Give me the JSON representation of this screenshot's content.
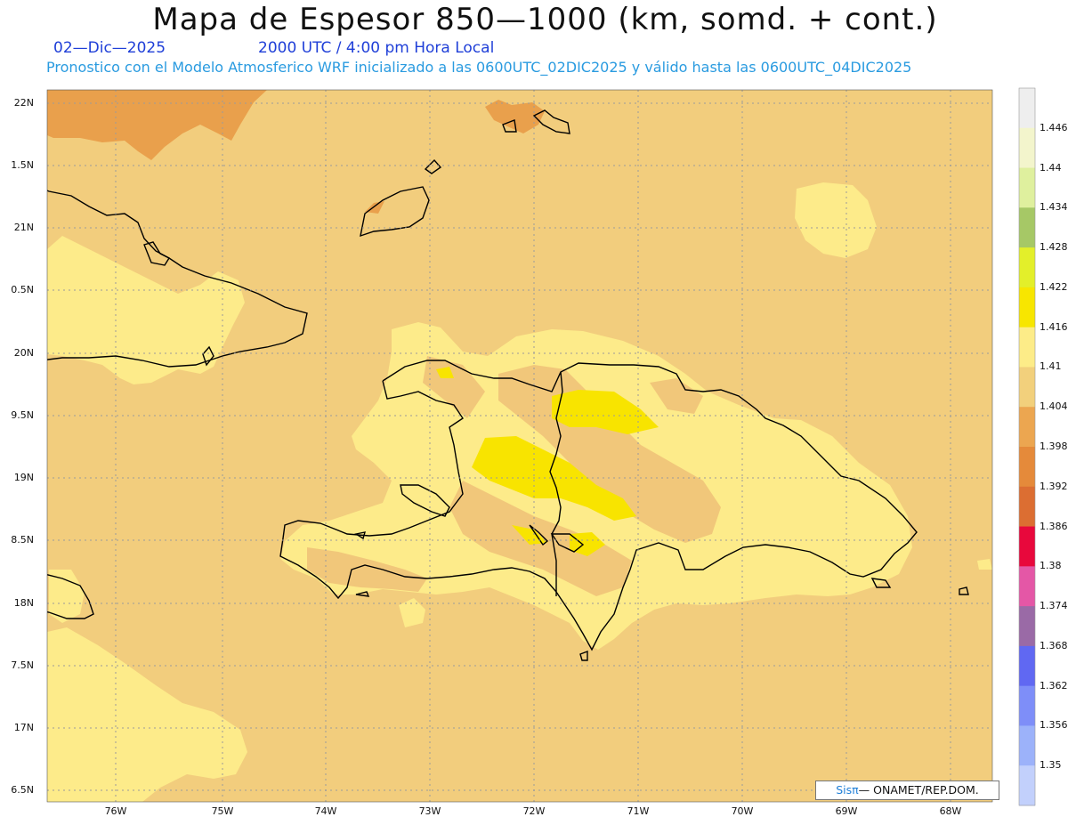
{
  "header": {
    "title": "Mapa de Espesor 850—1000 (km, somd. + cont.)",
    "date": "02—Dic—2025",
    "time": "2000 UTC / 4:00 pm Hora Local",
    "forecast": "Pronostico con el Modelo Atmosferico WRF inicializado a las 0600UTC_02DIC2025 y válido hasta las  0600UTC_04DIC2025"
  },
  "axes": {
    "lat_labels": [
      "22N",
      "1.5N",
      "21N",
      "0.5N",
      "20N",
      "9.5N",
      "19N",
      "8.5N",
      "18N",
      "7.5N",
      "17N",
      "6.5N"
    ],
    "lon_labels": [
      "76W",
      "75W",
      "74W",
      "73W",
      "72W",
      "71W",
      "70W",
      "69W",
      "68W"
    ]
  },
  "colorbar": {
    "labels": [
      "1.446",
      "1.44",
      "1.434",
      "1.428",
      "1.422",
      "1.416",
      "1.41",
      "1.404",
      "1.398",
      "1.392",
      "1.386",
      "1.38",
      "1.374",
      "1.368",
      "1.362",
      "1.356",
      "1.35"
    ],
    "colors": [
      "#eeeeee",
      "#f3f5cc",
      "#dff09e",
      "#a6c866",
      "#e3ef2a",
      "#f7e600",
      "#fdec88",
      "#f2d07c",
      "#eca650",
      "#e58a3a",
      "#dc6e32",
      "#e8083c",
      "#e457a6",
      "#9a6aa6",
      "#6068f2",
      "#7e8ef8",
      "#9cb2fa",
      "#c2d0fc"
    ]
  },
  "palette": {
    "ocean": "#f2cd7d",
    "land_light": "#fdeb8a",
    "land_mid": "#f1c77a",
    "high": "#f8e400",
    "low": "#e9a04c",
    "coast": "#000000",
    "grid": "#9a9a9a"
  },
  "credit": {
    "logo": "Sisπ",
    "text": "— ONAMET/REP.DOM."
  }
}
